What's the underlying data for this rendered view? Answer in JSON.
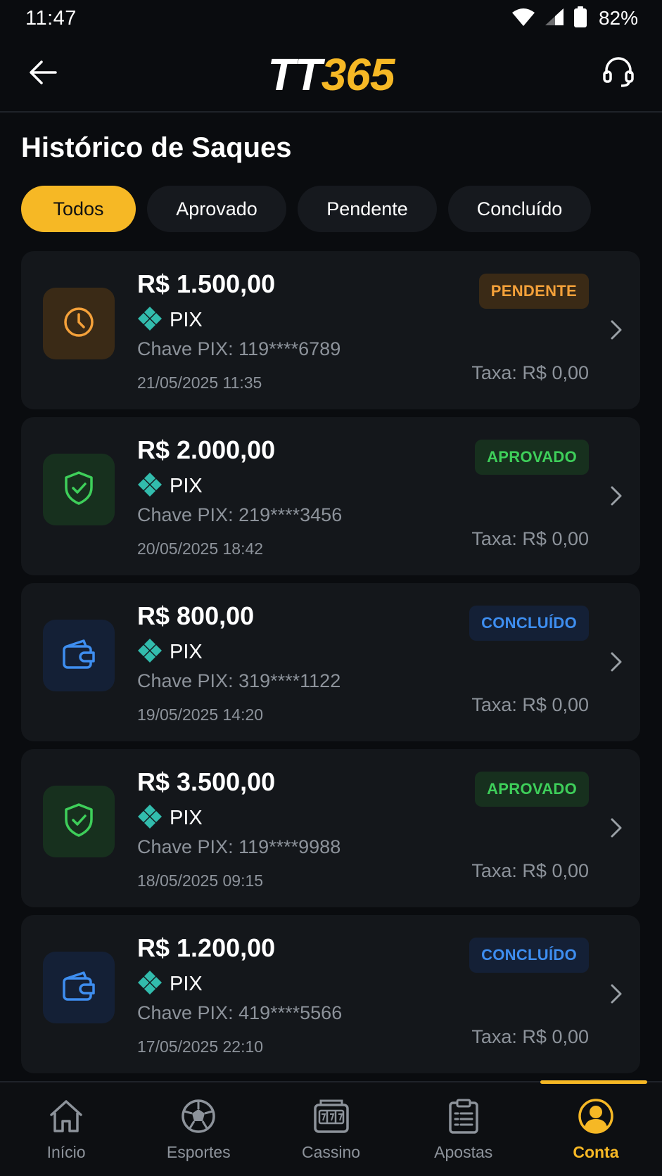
{
  "status_bar": {
    "time": "11:47",
    "battery": "82%"
  },
  "header": {
    "logo_tt": "TT",
    "logo_num": "365"
  },
  "page": {
    "title": "Histórico de Saques"
  },
  "filters": [
    {
      "label": "Todos",
      "active": true
    },
    {
      "label": "Aprovado",
      "active": false
    },
    {
      "label": "Pendente",
      "active": false
    },
    {
      "label": "Concluído",
      "active": false
    }
  ],
  "withdrawals": [
    {
      "amount": "R$ 1.500,00",
      "method": "PIX",
      "key": "Chave PIX: 119****6789",
      "date": "21/05/2025 11:35",
      "status": "PENDENTE",
      "fee": "Taxa: R$ 0,00",
      "icon": "clock-icon"
    },
    {
      "amount": "R$ 2.000,00",
      "method": "PIX",
      "key": "Chave PIX: 219****3456",
      "date": "20/05/2025 18:42",
      "status": "APROVADO",
      "fee": "Taxa: R$ 0,00",
      "icon": "shield-check-icon"
    },
    {
      "amount": "R$ 800,00",
      "method": "PIX",
      "key": "Chave PIX: 319****1122",
      "date": "19/05/2025 14:20",
      "status": "CONCLUÍDO",
      "fee": "Taxa: R$ 0,00",
      "icon": "wallet-icon"
    },
    {
      "amount": "R$ 3.500,00",
      "method": "PIX",
      "key": "Chave PIX: 119****9988",
      "date": "18/05/2025 09:15",
      "status": "APROVADO",
      "fee": "Taxa: R$ 0,00",
      "icon": "shield-check-icon"
    },
    {
      "amount": "R$ 1.200,00",
      "method": "PIX",
      "key": "Chave PIX: 419****5566",
      "date": "17/05/2025 22:10",
      "status": "CONCLUÍDO",
      "fee": "Taxa: R$ 0,00",
      "icon": "wallet-icon"
    }
  ],
  "nav": [
    {
      "label": "Início",
      "icon": "home-icon"
    },
    {
      "label": "Esportes",
      "icon": "soccer-ball-icon"
    },
    {
      "label": "Cassino",
      "icon": "slot-machine-icon"
    },
    {
      "label": "Apostas",
      "icon": "clipboard-icon"
    },
    {
      "label": "Conta",
      "icon": "user-icon",
      "active": true
    }
  ],
  "colors": {
    "accent": "#f6b825",
    "pending": "#f5a13a",
    "approved": "#3ecf5a",
    "done": "#3e8ef0",
    "pix": "#32bcad"
  }
}
